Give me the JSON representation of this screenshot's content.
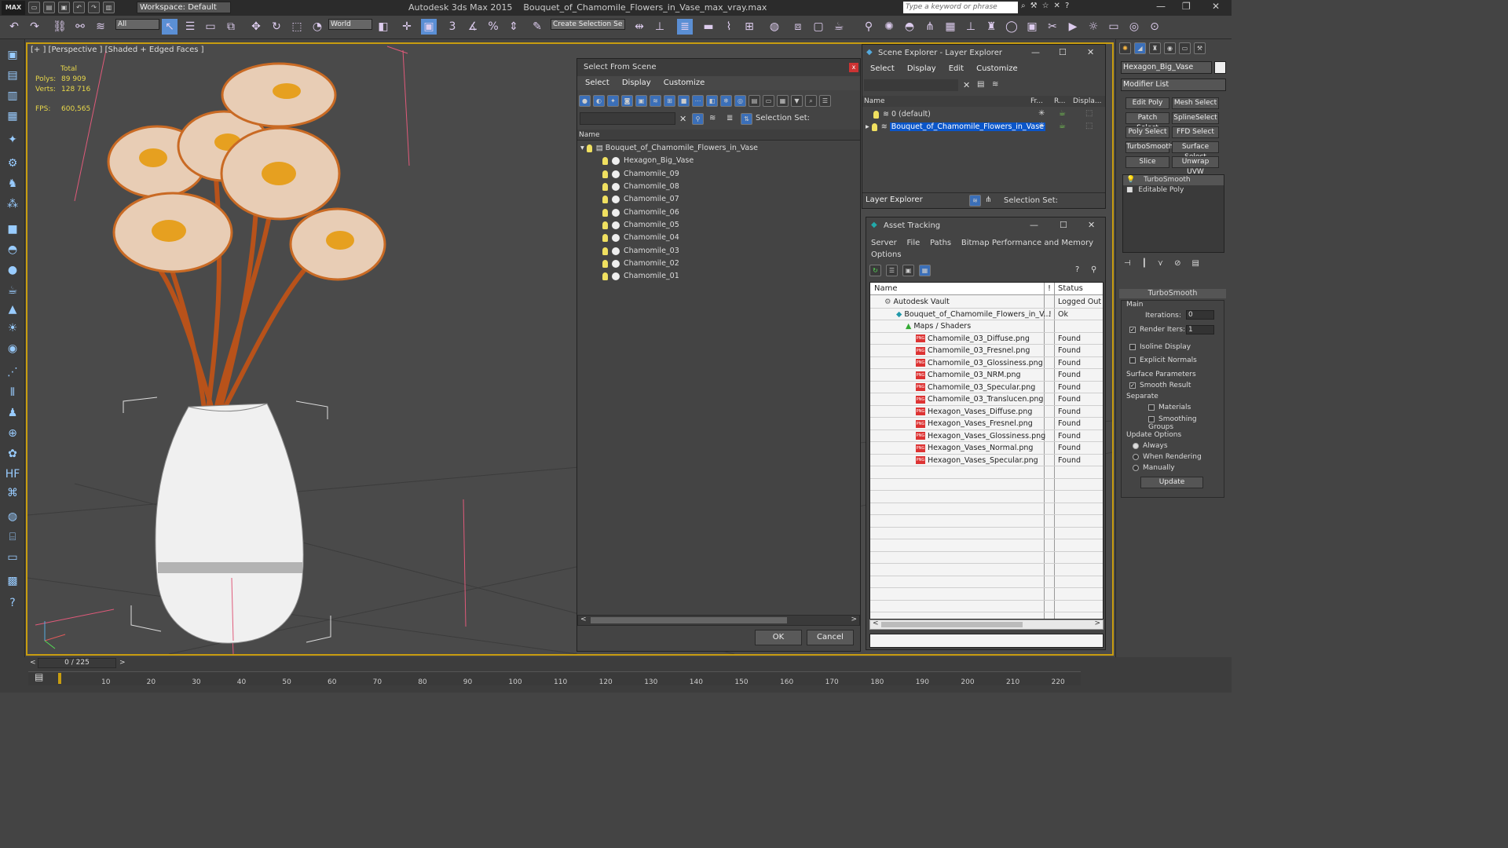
{
  "app": {
    "logo": "MAX",
    "workspace": "Workspace: Default",
    "title": "Autodesk 3ds Max  2015",
    "file": "Bouquet_of_Chamomile_Flowers_in_Vase_max_vray.max",
    "search_placeholder": "Type a keyword or phrase"
  },
  "toolbar": {
    "filter": "All",
    "refcoord": "World",
    "selset": "Create Selection Se"
  },
  "viewport": {
    "label": "[+ ] [Perspective ] [Shaded + Edged Faces ]",
    "stats": {
      "total": "Total",
      "polys_label": "Polys:",
      "polys": "89 909",
      "verts_label": "Verts:",
      "verts": "128 716",
      "fps_label": "FPS:",
      "fps": "600,565"
    }
  },
  "select_from_scene": {
    "title": "Select From Scene",
    "close": "x",
    "menu": [
      "Select",
      "Display",
      "Customize"
    ],
    "selection_set": "Selection Set:",
    "column": "Name",
    "root": "Bouquet_of_Chamomile_Flowers_in_Vase",
    "items": [
      "Hexagon_Big_Vase",
      "Chamomile_09",
      "Chamomile_08",
      "Chamomile_07",
      "Chamomile_06",
      "Chamomile_05",
      "Chamomile_04",
      "Chamomile_03",
      "Chamomile_02",
      "Chamomile_01"
    ],
    "ok": "OK",
    "cancel": "Cancel"
  },
  "scene_explorer": {
    "title": "Scene Explorer - Layer Explorer",
    "menu": [
      "Select",
      "Display",
      "Edit",
      "Customize"
    ],
    "columns": [
      "Name",
      "Fr...",
      "R...",
      "Displa..."
    ],
    "layers": [
      "0 (default)",
      "Bouquet_of_Chamomile_Flowers_in_Vase"
    ],
    "footer_dropdown": "Layer Explorer",
    "footer_selset": "Selection Set:"
  },
  "asset_tracking": {
    "title": "Asset Tracking",
    "menu": [
      "Server",
      "File",
      "Paths",
      "Bitmap Performance and Memory",
      "Options"
    ],
    "col_name": "Name",
    "col_flag": "!",
    "col_status": "Status",
    "rows": [
      {
        "name": "Autodesk Vault",
        "flag": "",
        "status": "Logged Out ..."
      },
      {
        "name": "Bouquet_of_Chamomile_Flowers_in_V...",
        "flag": "!",
        "status": "Ok"
      },
      {
        "name": "Maps / Shaders",
        "flag": "",
        "status": ""
      },
      {
        "name": "Chamomile_03_Diffuse.png",
        "flag": "",
        "status": "Found"
      },
      {
        "name": "Chamomile_03_Fresnel.png",
        "flag": "",
        "status": "Found"
      },
      {
        "name": "Chamomile_03_Glossiness.png",
        "flag": "",
        "status": "Found"
      },
      {
        "name": "Chamomile_03_NRM.png",
        "flag": "",
        "status": "Found"
      },
      {
        "name": "Chamomile_03_Specular.png",
        "flag": "",
        "status": "Found"
      },
      {
        "name": "Chamomile_03_Translucen.png",
        "flag": "",
        "status": "Found"
      },
      {
        "name": "Hexagon_Vases_Diffuse.png",
        "flag": "",
        "status": "Found"
      },
      {
        "name": "Hexagon_Vases_Fresnel.png",
        "flag": "",
        "status": "Found"
      },
      {
        "name": "Hexagon_Vases_Glossiness.png",
        "flag": "",
        "status": "Found"
      },
      {
        "name": "Hexagon_Vases_Normal.png",
        "flag": "",
        "status": "Found"
      },
      {
        "name": "Hexagon_Vases_Specular.png",
        "flag": "",
        "status": "Found"
      }
    ]
  },
  "command_panel": {
    "object_name": "Hexagon_Big_Vase",
    "modifier_list": "Modifier List",
    "mod_buttons": [
      "Edit Poly",
      "Mesh Select",
      "Patch Select",
      "SplineSelect",
      "Poly Select",
      "FFD Select",
      "TurboSmooth",
      "Surface Select",
      "Slice",
      "Unwrap UVW"
    ],
    "stack": [
      "TurboSmooth",
      "Editable Poly"
    ],
    "rollout": "TurboSmooth",
    "main": "Main",
    "iterations_label": "Iterations:",
    "iterations": "0",
    "render_iters_label": "Render Iters:",
    "render_iters": "1",
    "isoline": "Isoline Display",
    "explicit_normals": "Explicit Normals",
    "surface_params": "Surface Parameters",
    "smooth_result": "Smooth Result",
    "separate": "Separate",
    "materials": "Materials",
    "smoothing_groups": "Smoothing Groups",
    "update_options": "Update Options",
    "always": "Always",
    "when_rendering": "When Rendering",
    "manually": "Manually",
    "update": "Update"
  },
  "timeline": {
    "frame": "0 / 225",
    "ticks": [
      "10",
      "20",
      "30",
      "40",
      "50",
      "60",
      "70",
      "80",
      "90",
      "100",
      "110",
      "120",
      "130",
      "140",
      "150",
      "160",
      "170",
      "180",
      "190",
      "200",
      "210",
      "220"
    ]
  },
  "colors": {
    "active_border": "#c89d10",
    "selected_row": "#0a55c8",
    "stats_text": "#e8d74a"
  }
}
